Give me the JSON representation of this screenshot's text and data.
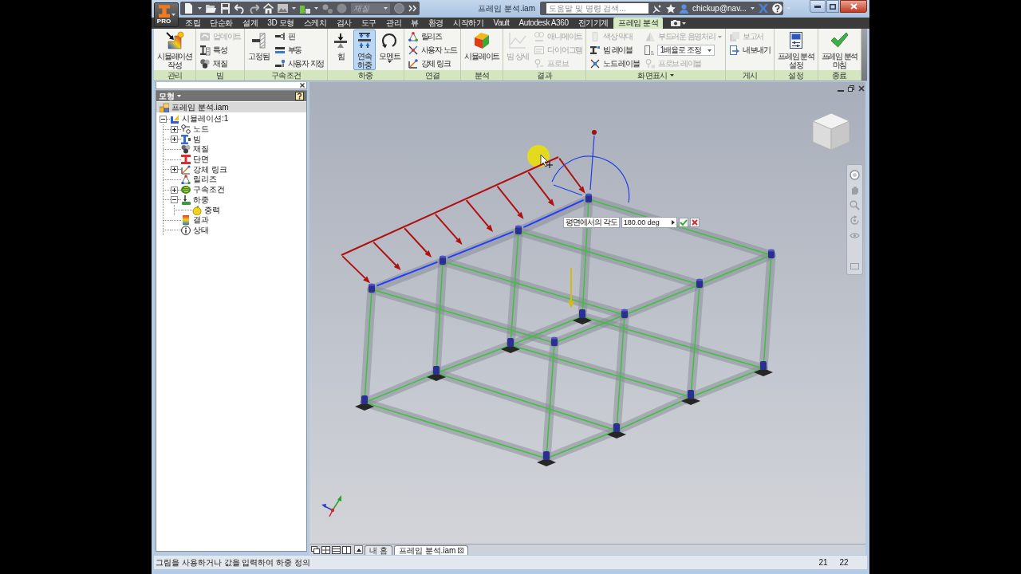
{
  "window": {
    "title": "프레임 분석.iam"
  },
  "app_button": {
    "badge": "PRO"
  },
  "quick_access": {
    "dropdown": {
      "value": "재질",
      "disabled": true
    }
  },
  "help_search": {
    "placeholder": "도움말 및 명령 검색..."
  },
  "account": {
    "user": "chickup@nav..."
  },
  "ribbon_tabs": [
    {
      "label": "조립",
      "selected": false
    },
    {
      "label": "단순화",
      "selected": false
    },
    {
      "label": "설계",
      "selected": false
    },
    {
      "label": "3D 모형",
      "selected": false
    },
    {
      "label": "스케치",
      "selected": false
    },
    {
      "label": "검사",
      "selected": false
    },
    {
      "label": "도구",
      "selected": false
    },
    {
      "label": "관리",
      "selected": false
    },
    {
      "label": "뷰",
      "selected": false
    },
    {
      "label": "환경",
      "selected": false
    },
    {
      "label": "시작하기",
      "selected": false
    },
    {
      "label": "Vault",
      "selected": false
    },
    {
      "label": "Autodesk A360",
      "selected": false
    },
    {
      "label": "전기기계",
      "selected": false
    },
    {
      "label": "프레임 분석",
      "selected": true
    }
  ],
  "ribbon_panels": [
    {
      "title": "관리",
      "tools": [
        {
          "kind": "large",
          "label": "시뮬레이션\n작성",
          "disabled": false,
          "selected": false
        }
      ]
    },
    {
      "title": "빔",
      "tools": [
        {
          "kind": "small",
          "label": "업데이트",
          "disabled": true,
          "selected": false
        },
        {
          "kind": "small",
          "label": "특성",
          "disabled": false,
          "selected": false
        },
        {
          "kind": "small",
          "label": "재질",
          "disabled": false,
          "selected": false
        }
      ]
    },
    {
      "title": "구속조건",
      "tools": [
        {
          "kind": "large",
          "label": "고정됨",
          "disabled": false,
          "selected": false
        },
        {
          "kind": "small",
          "label": "핀",
          "disabled": false,
          "selected": false
        },
        {
          "kind": "small",
          "label": "부동",
          "disabled": false,
          "selected": false
        },
        {
          "kind": "small",
          "label": "사용자 지정",
          "disabled": false,
          "selected": false
        }
      ]
    },
    {
      "title": "하중",
      "tools": [
        {
          "kind": "large",
          "label": "힘",
          "disabled": false,
          "selected": false
        },
        {
          "kind": "large",
          "label": "연속\n하중",
          "disabled": false,
          "selected": true
        },
        {
          "kind": "large",
          "label": "모멘트",
          "disabled": false,
          "selected": false,
          "caret": true
        }
      ]
    },
    {
      "title": "연결",
      "tools": [
        {
          "kind": "small",
          "label": "릴리즈",
          "disabled": false,
          "selected": false
        },
        {
          "kind": "small",
          "label": "사용자 노드",
          "disabled": false,
          "selected": false
        },
        {
          "kind": "small",
          "label": "강체 링크",
          "disabled": false,
          "selected": false
        }
      ]
    },
    {
      "title": "분석",
      "tools": [
        {
          "kind": "large",
          "label": "시뮬레이트",
          "disabled": false,
          "selected": false
        }
      ]
    },
    {
      "title": "결과",
      "tools": [
        {
          "kind": "large",
          "label": "빔 상세",
          "disabled": true,
          "selected": false
        },
        {
          "kind": "small",
          "label": "애니메이트",
          "disabled": true,
          "selected": false
        },
        {
          "kind": "small",
          "label": "다이어그램",
          "disabled": true,
          "selected": false
        },
        {
          "kind": "small",
          "label": "프로브",
          "disabled": true,
          "selected": false
        }
      ]
    },
    {
      "title": "화면표시",
      "menu": true,
      "tools": [
        {
          "kind": "small",
          "label": "색상 막대",
          "disabled": true,
          "selected": false
        },
        {
          "kind": "small",
          "label": "빔 레이블",
          "disabled": false,
          "selected": false
        },
        {
          "kind": "small",
          "label": "노드 레이블",
          "disabled": false,
          "selected": false
        },
        {
          "kind": "small",
          "label": "부드러운 음영처리",
          "disabled": true,
          "selected": false,
          "caret": true
        },
        {
          "kind": "combo",
          "value": "1배율로 조정",
          "disabled": false,
          "selected": false
        },
        {
          "kind": "small",
          "label": "프로브 레이블",
          "disabled": true,
          "selected": false
        }
      ]
    },
    {
      "title": "게시",
      "tools": [
        {
          "kind": "small",
          "label": "보고서",
          "disabled": true,
          "selected": false
        },
        {
          "kind": "small",
          "label": "내보내기",
          "disabled": false,
          "selected": false
        }
      ]
    },
    {
      "title": "설정",
      "tools": [
        {
          "kind": "large",
          "label": "프레임 분석\n설정",
          "disabled": false,
          "selected": false
        }
      ]
    },
    {
      "title": "종료",
      "tools": [
        {
          "kind": "large",
          "label": "프레임 분석\n마침",
          "disabled": false,
          "selected": false
        }
      ]
    }
  ],
  "browser": {
    "title": "모형",
    "tree": [
      {
        "label": "프레임 분석.iam",
        "children": [
          {
            "label": "시뮬레이션:1",
            "expanded": true,
            "children": [
              {
                "label": "노드",
                "expanded": false
              },
              {
                "label": "빔",
                "expanded": false
              },
              {
                "label": "재질"
              },
              {
                "label": "단면"
              },
              {
                "label": "강체 링크",
                "expanded": false
              },
              {
                "label": "릴리즈"
              },
              {
                "label": "구속조건",
                "expanded": false
              },
              {
                "label": "하중",
                "expanded": true,
                "children": [
                  {
                    "label": "중력"
                  }
                ]
              },
              {
                "label": "결과"
              },
              {
                "label": "상태"
              }
            ]
          }
        ]
      }
    ]
  },
  "viewport": {
    "angle_input": {
      "label": "평면에서의 각도",
      "value": "180.00 deg"
    }
  },
  "document_tabs": [
    {
      "label": "내 홈",
      "selected": false
    },
    {
      "label": "프레임 분석.iam",
      "selected": true
    }
  ],
  "status_bar": {
    "prompt": "그림을 사용하거나 값을 입력하여 하중 정의",
    "values": [
      "21",
      "22"
    ]
  }
}
